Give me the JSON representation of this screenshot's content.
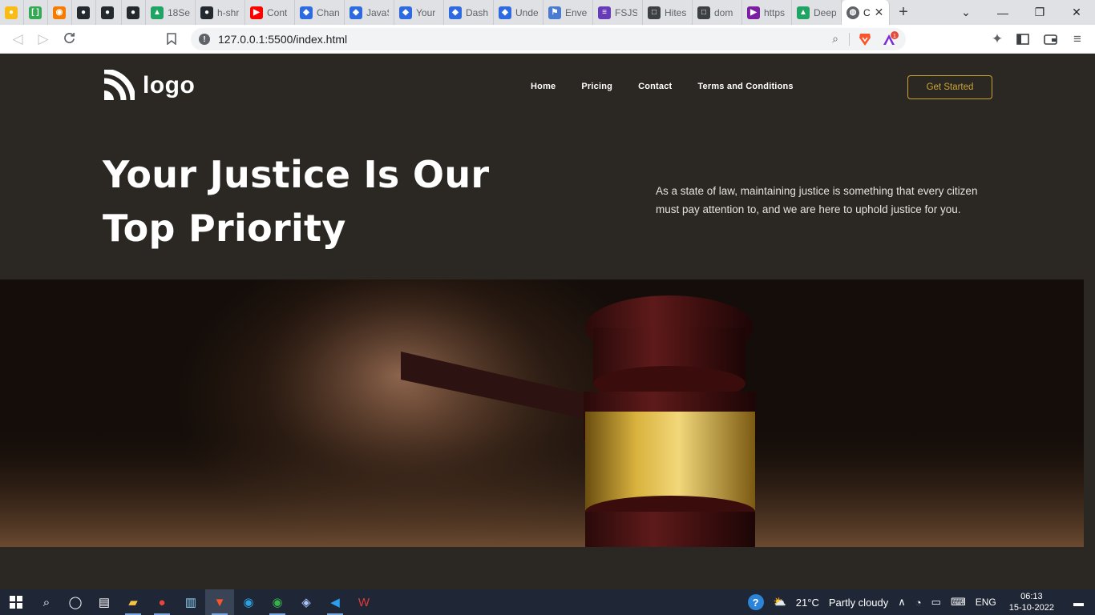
{
  "browser": {
    "tabs": [
      {
        "label": "",
        "icon": "keep-icon",
        "color": "#f9bc15"
      },
      {
        "label": "",
        "icon": "brackets-icon",
        "color": "#34a853"
      },
      {
        "label": "",
        "icon": "extension-icon",
        "color": "#f57c00"
      },
      {
        "label": "",
        "icon": "github-icon",
        "color": "#24292f"
      },
      {
        "label": "",
        "icon": "github-icon",
        "color": "#24292f"
      },
      {
        "label": "",
        "icon": "github-icon",
        "color": "#24292f"
      },
      {
        "label": "18Se",
        "icon": "drive-icon",
        "color": "#1fa463"
      },
      {
        "label": "h-shr",
        "icon": "github-icon",
        "color": "#24292f"
      },
      {
        "label": "Cont",
        "icon": "youtube-icon",
        "color": "#ff0000"
      },
      {
        "label": "Chan",
        "icon": "diamond-icon",
        "color": "#2f6be0"
      },
      {
        "label": "JavaS",
        "icon": "diamond-icon",
        "color": "#2f6be0"
      },
      {
        "label": "Your",
        "icon": "diamond-icon",
        "color": "#2f6be0"
      },
      {
        "label": "Dash",
        "icon": "diamond-icon",
        "color": "#2f6be0"
      },
      {
        "label": "Unde",
        "icon": "diamond-icon",
        "color": "#2f6be0"
      },
      {
        "label": "Envel",
        "icon": "flag-icon",
        "color": "#4a7bd0"
      },
      {
        "label": "FSJS",
        "icon": "forms-icon",
        "color": "#673ab7"
      },
      {
        "label": "Hites",
        "icon": "square-icon",
        "color": "#3c4043"
      },
      {
        "label": "dom",
        "icon": "square-icon",
        "color": "#3c4043"
      },
      {
        "label": "https",
        "icon": "play-icon",
        "color": "#7b1fa2"
      },
      {
        "label": "Deep",
        "icon": "drive-icon",
        "color": "#1fa463"
      }
    ],
    "active_tab": {
      "label": "C",
      "icon": "globe-icon"
    },
    "new_tab": "+",
    "url": "127.0.0.1:5500/index.html",
    "rewards_badge": "1"
  },
  "site": {
    "logo_text": "logo",
    "nav": [
      "Home",
      "Pricing",
      "Contact",
      "Terms and Conditions"
    ],
    "cta": "Get Started",
    "hero_title_line1": "Your Justice Is Our",
    "hero_title_line2": "Top Priority",
    "hero_description": "As a state of law, maintaining justice is something that every citizen must pay attention to, and we are here to uphold justice for you.",
    "colors": {
      "background": "#2b2823",
      "accent": "#c9a437",
      "text": "#ffffff"
    }
  },
  "taskbar": {
    "weather_temp": "21°C",
    "weather_text": "Partly cloudy",
    "language": "ENG",
    "time": "06:13",
    "date": "15-10-2022"
  }
}
